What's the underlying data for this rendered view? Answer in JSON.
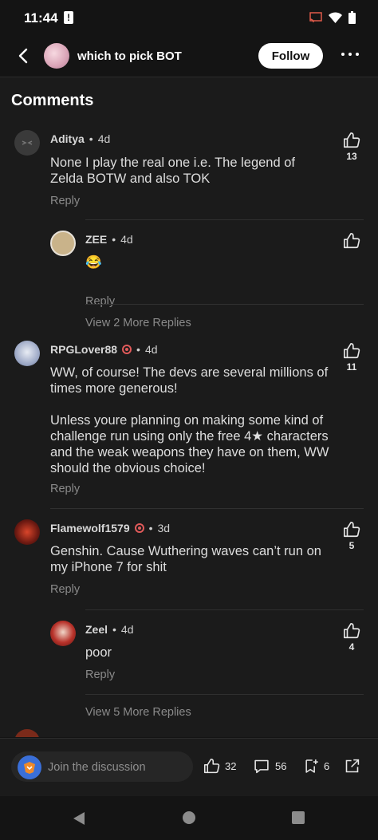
{
  "status": {
    "time": "11:44",
    "alert_glyph": "!"
  },
  "header": {
    "bot_name": "which to pick BOT",
    "follow_label": "Follow"
  },
  "section": {
    "title": "Comments"
  },
  "comments": [
    {
      "user": "Aditya",
      "time": "4d",
      "text": "None I play the real one i.e. The legend of Zelda BOTW and also TOK",
      "likes": "13",
      "reply": "Reply"
    },
    {
      "user": "ZEE",
      "time": "4d",
      "text": "😂",
      "likes": "",
      "reply": "Reply"
    },
    {
      "user": "RPGLover88",
      "time": "4d",
      "text": "WW, of course! The devs are several millions of times more generous!\n\nUnless youre planning on making some kind of challenge run using only the free 4★ characters and the weak weapons they have on them,  WW should the obvious choice!",
      "likes": "11",
      "reply": "Reply"
    },
    {
      "user": "Flamewolf1579",
      "time": "3d",
      "text": "Genshin. Cause Wuthering waves can’t run on my iPhone 7 for shit",
      "likes": "5",
      "reply": "Reply"
    },
    {
      "user": "Zeel",
      "time": "4d",
      "text": "poor",
      "likes": "4",
      "reply": "Reply"
    }
  ],
  "view_more": [
    "View 2 More Replies",
    "View 5 More Replies"
  ],
  "bottom": {
    "placeholder": "Join the discussion",
    "likes": "32",
    "comments": "56",
    "saves": "6"
  },
  "icons": [
    "back-icon",
    "more-icon",
    "thumb-up-icon",
    "comment-icon",
    "bookmark-add-icon",
    "share-icon"
  ]
}
